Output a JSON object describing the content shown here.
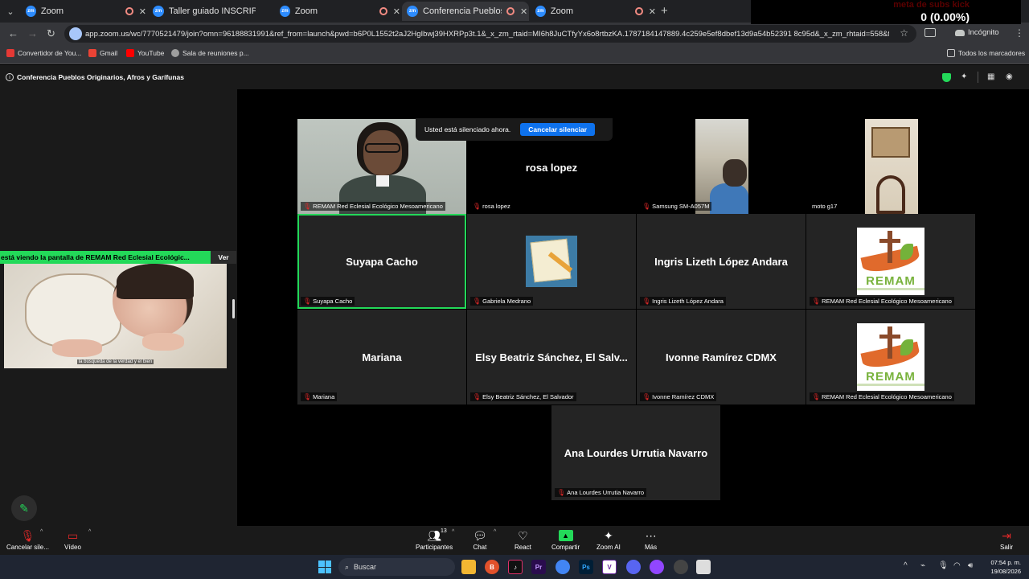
{
  "browser": {
    "tabs": [
      {
        "label": "Zoom",
        "active": false
      },
      {
        "label": "Taller guiado INSCRIPCION AL",
        "active": false
      },
      {
        "label": "Zoom",
        "active": false
      },
      {
        "label": "Conferencia Pueblos Origin",
        "active": true
      },
      {
        "label": "Zoom",
        "active": false
      }
    ],
    "new_tab": "+",
    "url": "app.zoom.us/wc/7770521479/join?omn=96188831991&ref_from=launch&pwd=b6P0L1552t2aJ2HgIbwj39HXRPp3t.1&_x_zm_rtaid=MI6h8JuCTfyYx6o8rtbzKA.1787184147889.4c259e5ef8dbef13d9a54b52391 8c95d&_x_zm_rhtaid=558&fromP...",
    "incognito_label": "Incógnito",
    "bookmarks": [
      {
        "label": "Convertidor de You...",
        "color": "#e53935"
      },
      {
        "label": "Gmail",
        "color": "#ea4335"
      },
      {
        "label": "YouTube",
        "color": "#ff0000"
      },
      {
        "label": "Sala de reuniones p...",
        "color": "#9e9e9e"
      }
    ],
    "all_bookmarks": "Todos los marcadores"
  },
  "overlay": {
    "title": "meta de subs kick",
    "value": "0 (0.00%)"
  },
  "meeting": {
    "title": "Conferencia Pueblos Originarios, Afros y Garífunas"
  },
  "toast": {
    "message": "Usted está silenciado ahora.",
    "button": "Cancelar silenciar"
  },
  "share": {
    "banner": "está viendo la pantalla de  REMAM Red Eclesial Ecológic...",
    "view_button": "Ver",
    "caption": "la búsqueda de la verdad y el bien"
  },
  "tiles": [
    {
      "name": "REMAM Red Eclesial Ecológico Mesoamericano",
      "big": "",
      "kind": "video-woman"
    },
    {
      "name": "rosa lopez",
      "big": "rosa lopez",
      "kind": "name"
    },
    {
      "name": "Samsung SM-A057M",
      "big": "",
      "kind": "video-samsung"
    },
    {
      "name": "moto g17",
      "big": "",
      "kind": "video-moto"
    },
    {
      "name": "Suyapa Cacho",
      "big": "Suyapa Cacho",
      "kind": "name"
    },
    {
      "name": "Gabriela Medrano",
      "big": "",
      "kind": "notebook"
    },
    {
      "name": "Ingris Lizeth López Andara",
      "big": "Ingris Lizeth López Andara",
      "kind": "name"
    },
    {
      "name": "REMAM Red Eclesial Ecológico Mesoamericano",
      "big": "",
      "kind": "logo"
    },
    {
      "name": "Mariana",
      "big": "Mariana",
      "kind": "name"
    },
    {
      "name": "Elsy Beatriz Sánchez, El Salvador",
      "big": "Elsy Beatriz Sánchez, El Salv...",
      "kind": "name"
    },
    {
      "name": "Ivonne Ramírez CDMX",
      "big": "Ivonne Ramírez CDMX",
      "kind": "name"
    },
    {
      "name": "REMAM Red Eclesial Ecológico Mesoamericano",
      "big": "",
      "kind": "logo"
    },
    {
      "name": "Ana Lourdes Urrutia Navarro",
      "big": "Ana Lourdes Urrutia Navarro",
      "kind": "name"
    }
  ],
  "remam_logo_text": "REMAM",
  "toolbar": {
    "unmute": "Cancelar sile...",
    "video": "Vídeo",
    "participants": "Participantes",
    "participants_count": "13",
    "chat": "Chat",
    "react": "React",
    "share": "Compartir",
    "zoom_ai": "Zoom AI",
    "more": "Más",
    "leave": "Salir"
  },
  "taskbar": {
    "search": "Buscar",
    "time": "07:54 p. m.",
    "date": "19/08/2026"
  }
}
